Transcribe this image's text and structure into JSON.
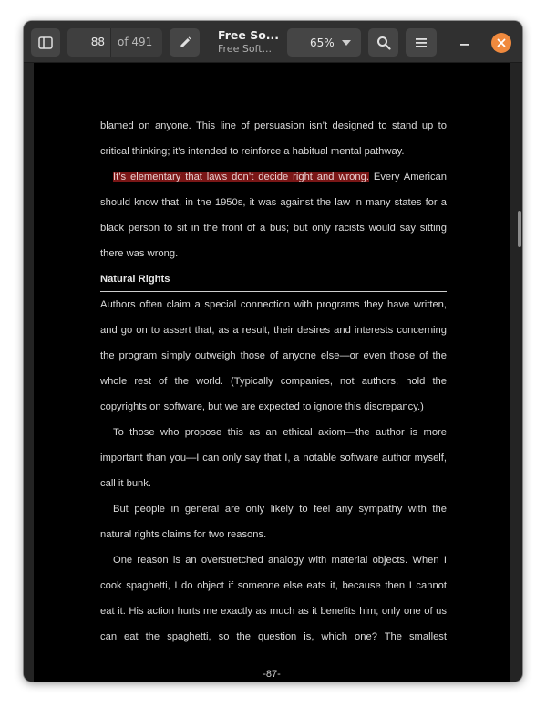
{
  "toolbar": {
    "page_current": "88",
    "page_total": "of 491",
    "title": "Free So...",
    "subtitle": "Free Soft...",
    "zoom": "65%",
    "icons": {
      "sidebar": "sidebar-toggle-icon",
      "annotate": "pencil-icon",
      "search": "search-icon",
      "menu": "hamburger-menu-icon",
      "minimize": "minimize-icon",
      "close": "close-icon"
    },
    "close_color": "#f08a3e"
  },
  "document": {
    "p1": [
      "blamed on anyone. This line of persuasion isn’t designed to stand up to",
      "critical thinking; it’s intended to reinforce a habitual mental pathway."
    ],
    "p2_highlight": "It’s elementary that laws don’t decide right and wrong.",
    "p2_rest": " Every American",
    "p2": [
      "should know that, in the 1950s, it was against the law in many states for a",
      "black person to sit in the front of a bus; but only racists would say sitting",
      "there was wrong."
    ],
    "heading": "Natural Rights",
    "p3": [
      "Authors often claim a special connection with programs they have written,",
      "and go on to assert that, as a result, their desires and interests concerning",
      "the program simply outweigh those of anyone else—or even those of the",
      "whole rest of the world. (Typically companies, not authors, hold the",
      "copyrights on software, but we are expected to ignore this discrepancy.)"
    ],
    "p4": [
      "To those who propose this as an ethical axiom—the author is more",
      "important than you—I can only say that I, a notable software author myself,",
      "call it bunk."
    ],
    "p5": [
      "But people in general are only likely to feel any sympathy with the",
      "natural rights claims for two reasons."
    ],
    "p6": [
      "One reason is an overstretched analogy with material objects. When I",
      "cook spaghetti, I do object if someone else eats it, because then I cannot",
      "eat it. His action hurts me exactly as much as it benefits him; only one of us",
      "can eat the spaghetti, so the question is, which one? The smallest"
    ],
    "page_number": "-87-",
    "highlight_color": "#7a1616"
  }
}
